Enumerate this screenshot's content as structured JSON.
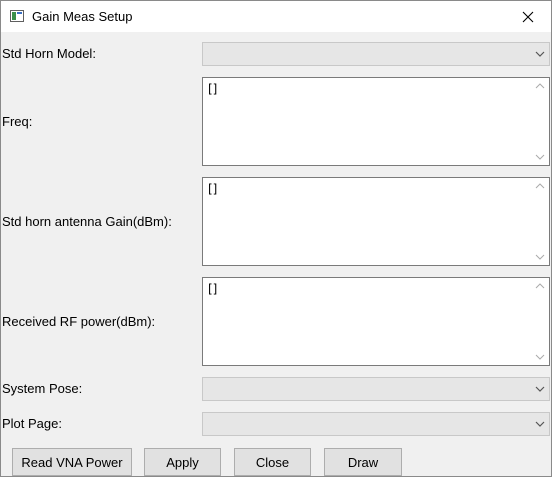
{
  "window": {
    "title": "Gain Meas Setup",
    "icons": {
      "app": "app-window-icon",
      "close": "close-icon"
    }
  },
  "form": {
    "std_horn_model": {
      "label": "Std Horn Model:",
      "value": ""
    },
    "freq": {
      "label": "Freq:",
      "value": "[]"
    },
    "std_horn_gain": {
      "label": "Std horn antenna Gain(dBm):",
      "value": "[]"
    },
    "received_rf_power": {
      "label": "Received RF power(dBm):",
      "value": "[]"
    },
    "system_pose": {
      "label": "System Pose:",
      "value": ""
    },
    "plot_page": {
      "label": "Plot Page:",
      "value": ""
    }
  },
  "buttons": {
    "read_vna_power": "Read VNA Power",
    "apply": "Apply",
    "close": "Close",
    "draw": "Draw"
  },
  "colors": {
    "window_bg": "#f0f0f0",
    "titlebar_bg": "#ffffff",
    "combo_bg": "#e6e6e6",
    "button_bg": "#e1e1e1"
  }
}
